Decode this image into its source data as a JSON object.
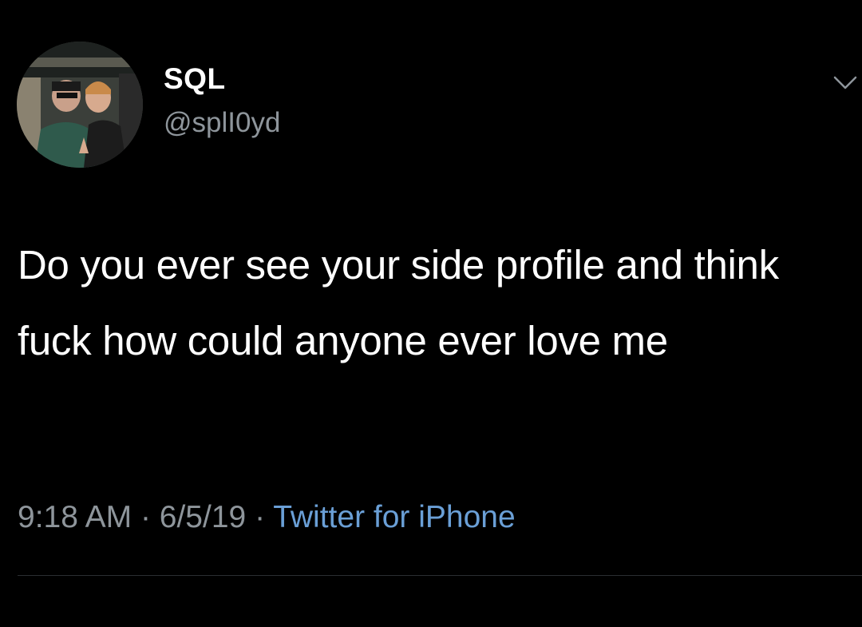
{
  "tweet": {
    "display_name": "SQL",
    "handle": "@splI0yd",
    "text": "Do you ever see your side profile and think fuck how could anyone ever love me",
    "time": "9:18 AM",
    "date": "6/5/19",
    "separator": "·",
    "source": "Twitter for iPhone"
  },
  "icons": {
    "menu": "chevron-down-icon",
    "avatar": "profile-photo"
  },
  "colors": {
    "background": "#000000",
    "text_primary": "#ffffff",
    "text_secondary": "#8e959b",
    "link": "#6a9fd6",
    "divider": "#2a2e32"
  }
}
